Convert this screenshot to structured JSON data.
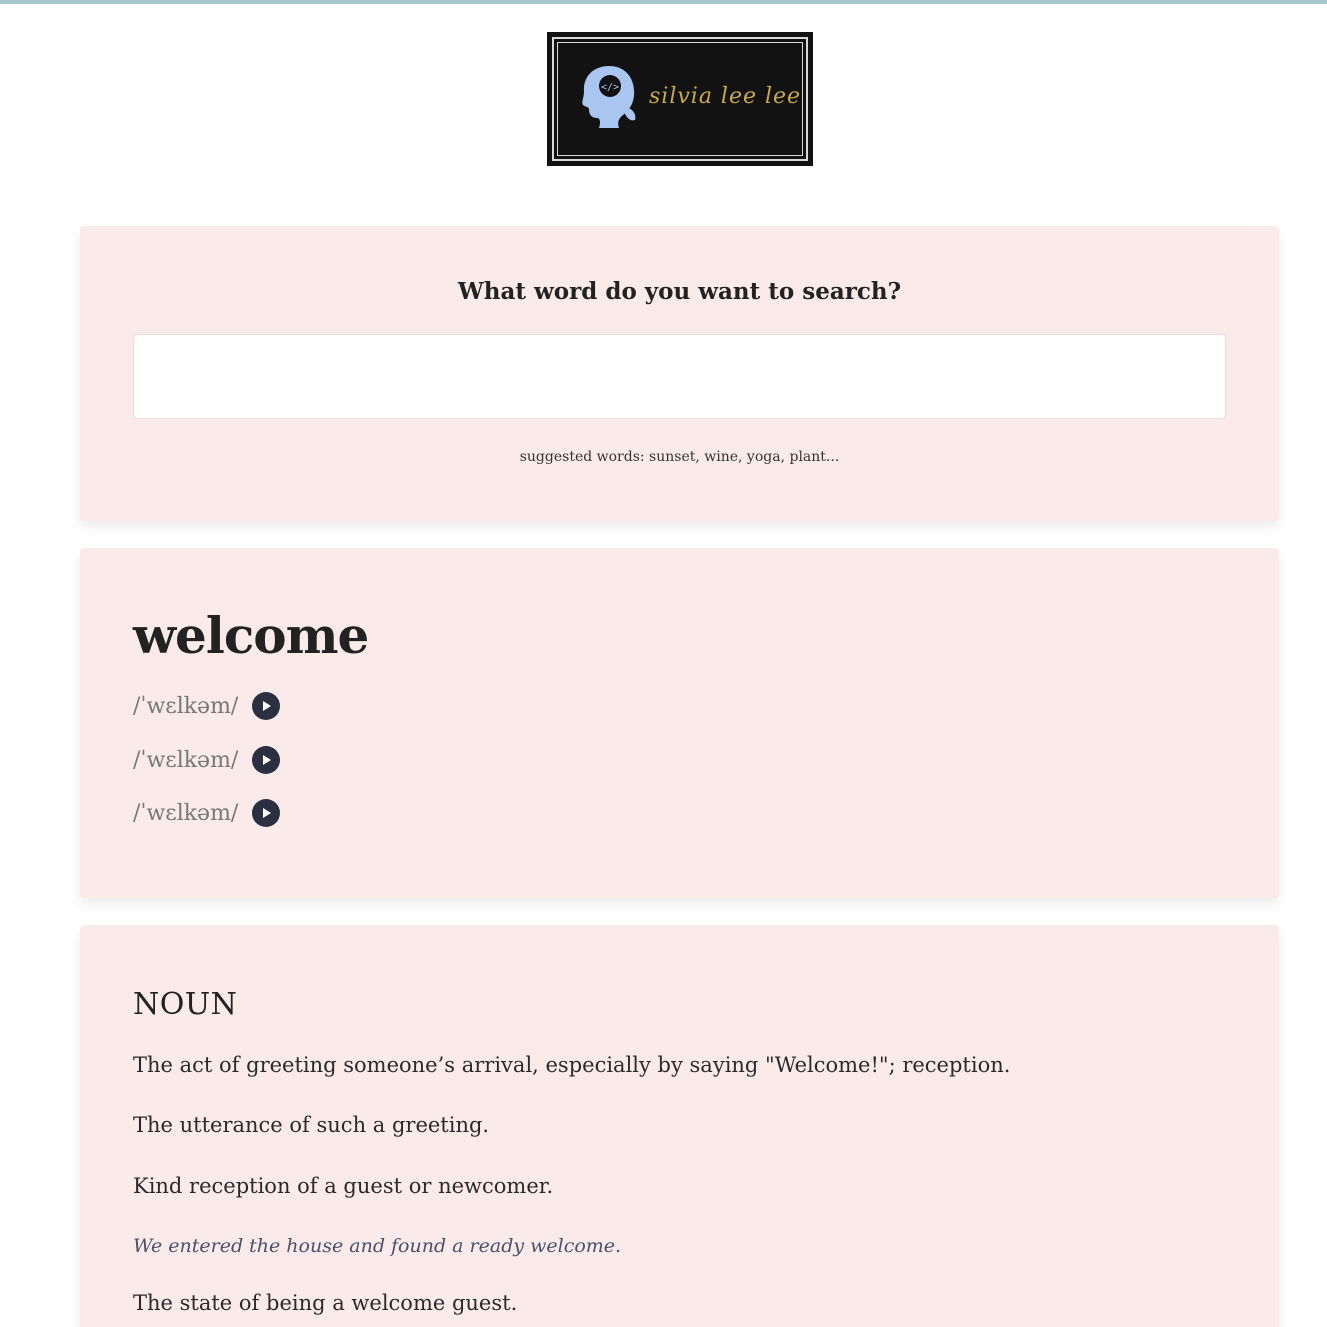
{
  "logo": {
    "brand_text": "silvia lee lee",
    "head_icon_code": "</>",
    "colors": {
      "background": "#121212",
      "script": "#c7a94c",
      "head": "#a9c6f0"
    }
  },
  "search": {
    "heading": "What word do you want to search?",
    "input_value": "",
    "suggested": "suggested words: sunset, wine, yoga, plant..."
  },
  "word": {
    "title": "welcome",
    "phonetics": [
      {
        "text": "/ˈwɛlkəm/",
        "icon": "play-icon"
      },
      {
        "text": "/ˈwɛlkəm/",
        "icon": "play-icon"
      },
      {
        "text": "/ˈwɛlkəm/",
        "icon": "play-icon"
      }
    ]
  },
  "meaning": {
    "part_of_speech": "NOUN",
    "definitions": [
      "The act of greeting someone’s arrival, especially by saying \"Welcome!\"; reception.",
      "The utterance of such a greeting.",
      "Kind reception of a guest or newcomer."
    ],
    "example": "We entered the house and found a ready welcome.",
    "definition_after_example": "The state of being a welcome guest."
  },
  "colors": {
    "card_background": "#faebea",
    "play_button": "#2a3040",
    "top_strip": "#a9c9cf"
  }
}
